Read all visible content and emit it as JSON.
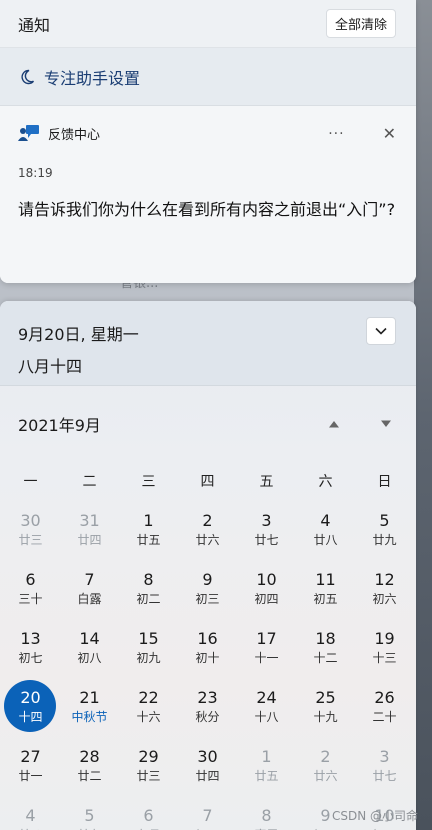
{
  "notifications": {
    "title": "通知",
    "clear_all": "全部清除",
    "focus_assist": "专注助手设置",
    "card": {
      "app": "反馈中心",
      "more": "···",
      "close": "✕",
      "time": "18:19",
      "message": "请告诉我们你为什么在看到所有内容之前退出“入门”?"
    },
    "background_item": "管银..."
  },
  "calendar": {
    "date": "9月20日, 星期一",
    "lunar": "八月十四",
    "month": "2021年9月",
    "weekdays": [
      "一",
      "二",
      "三",
      "四",
      "五",
      "六",
      "日"
    ],
    "weeks": [
      [
        {
          "d": "30",
          "l": "廿三",
          "dim": true
        },
        {
          "d": "31",
          "l": "廿四",
          "dim": true
        },
        {
          "d": "1",
          "l": "廿五"
        },
        {
          "d": "2",
          "l": "廿六"
        },
        {
          "d": "3",
          "l": "廿七"
        },
        {
          "d": "4",
          "l": "廿八"
        },
        {
          "d": "5",
          "l": "廿九"
        }
      ],
      [
        {
          "d": "6",
          "l": "三十"
        },
        {
          "d": "7",
          "l": "白露"
        },
        {
          "d": "8",
          "l": "初二"
        },
        {
          "d": "9",
          "l": "初三"
        },
        {
          "d": "10",
          "l": "初四"
        },
        {
          "d": "11",
          "l": "初五"
        },
        {
          "d": "12",
          "l": "初六"
        }
      ],
      [
        {
          "d": "13",
          "l": "初七"
        },
        {
          "d": "14",
          "l": "初八"
        },
        {
          "d": "15",
          "l": "初九"
        },
        {
          "d": "16",
          "l": "初十"
        },
        {
          "d": "17",
          "l": "十一"
        },
        {
          "d": "18",
          "l": "十二"
        },
        {
          "d": "19",
          "l": "十三"
        }
      ],
      [
        {
          "d": "20",
          "l": "十四",
          "today": true
        },
        {
          "d": "21",
          "l": "中秋节",
          "festival": true
        },
        {
          "d": "22",
          "l": "十六"
        },
        {
          "d": "23",
          "l": "秋分"
        },
        {
          "d": "24",
          "l": "十八"
        },
        {
          "d": "25",
          "l": "十九"
        },
        {
          "d": "26",
          "l": "二十"
        }
      ],
      [
        {
          "d": "27",
          "l": "廿一"
        },
        {
          "d": "28",
          "l": "廿二"
        },
        {
          "d": "29",
          "l": "廿三"
        },
        {
          "d": "30",
          "l": "廿四"
        },
        {
          "d": "1",
          "l": "廿五",
          "dim": true
        },
        {
          "d": "2",
          "l": "廿六",
          "dim": true
        },
        {
          "d": "3",
          "l": "廿七",
          "dim": true
        }
      ],
      [
        {
          "d": "4",
          "l": "廿八",
          "dim": true
        },
        {
          "d": "5",
          "l": "廿九",
          "dim": true
        },
        {
          "d": "6",
          "l": "九月",
          "dim": true
        },
        {
          "d": "7",
          "l": "初二",
          "dim": true
        },
        {
          "d": "8",
          "l": "寒露",
          "dim": true
        },
        {
          "d": "9",
          "l": "初四",
          "dim": true
        },
        {
          "d": "10",
          "l": "初五",
          "dim": true
        }
      ]
    ]
  },
  "watermark": "CSDN @小司命",
  "colors": {
    "accent": "#0b62b8",
    "focus_text": "#1a3d73"
  }
}
